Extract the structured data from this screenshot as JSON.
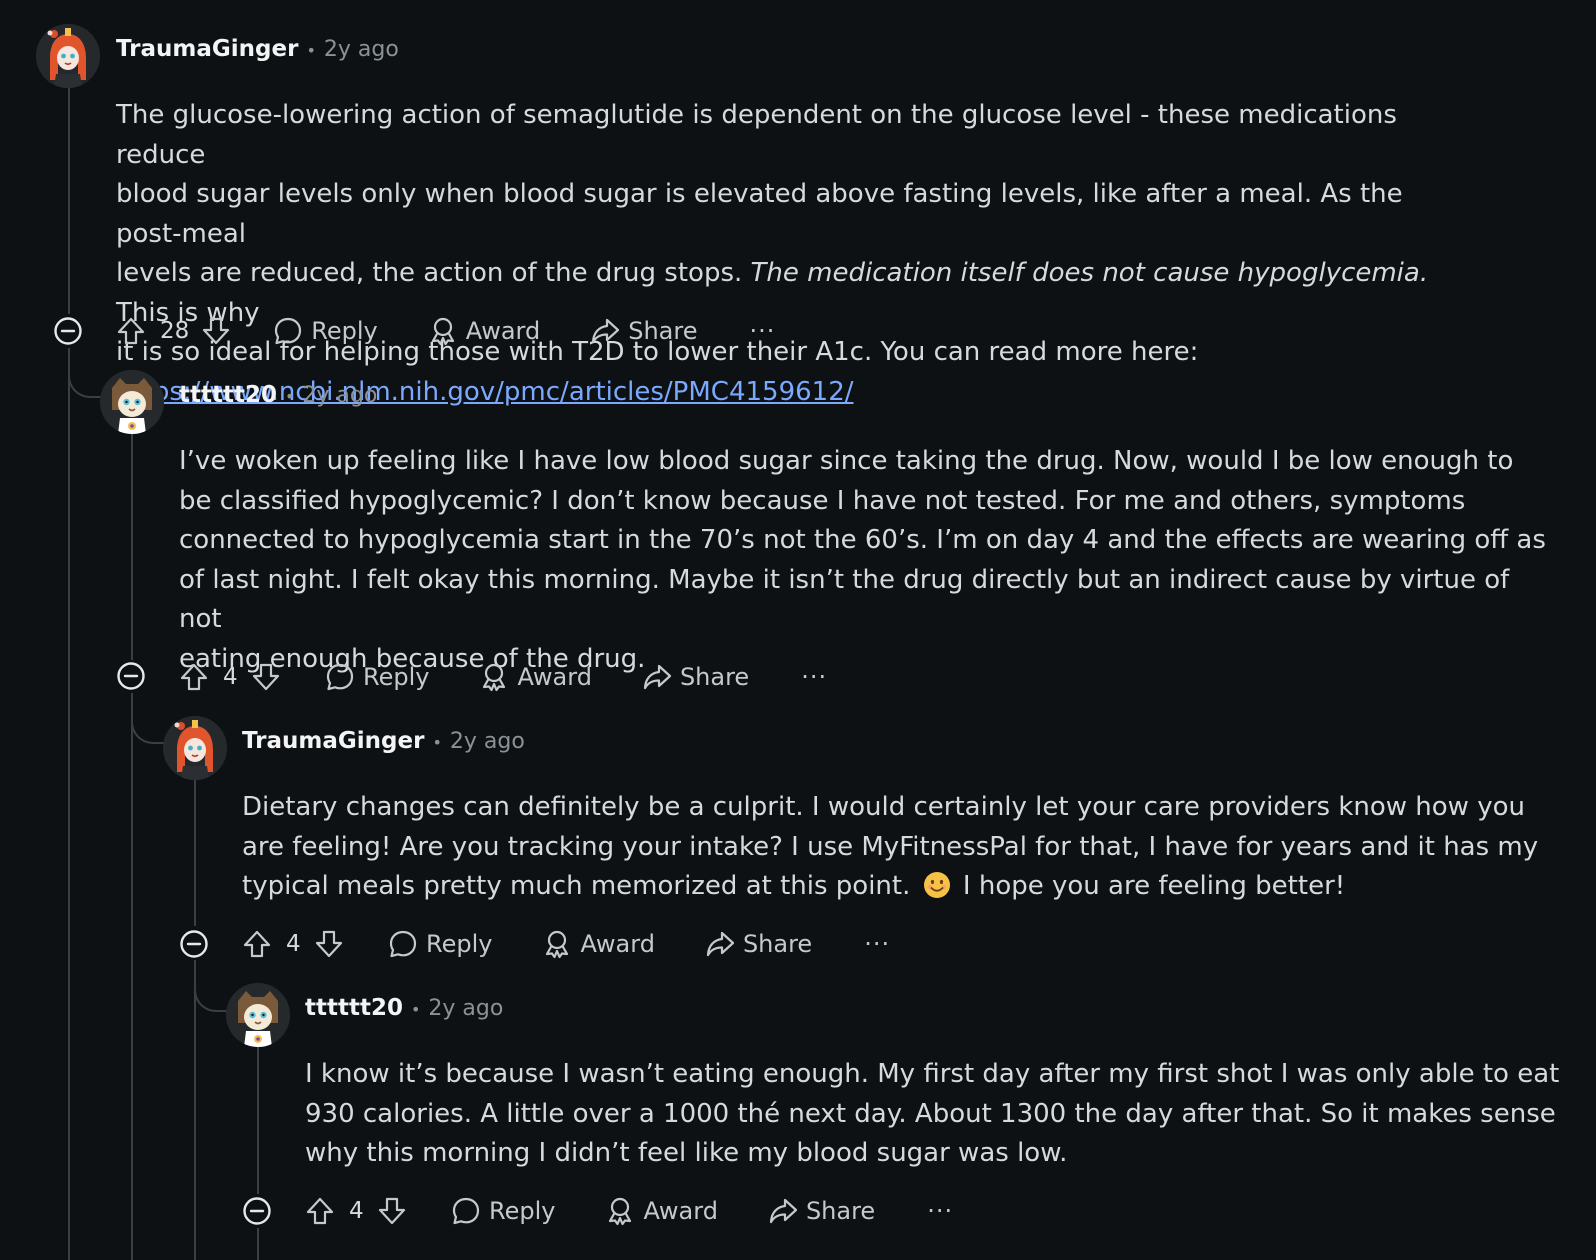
{
  "comments": [
    {
      "author": "TraumaGinger",
      "time": "2y ago",
      "body_line1": "The glucose-lowering action of semaglutide is dependent on the glucose level - these medications reduce",
      "body_line2": "blood sugar levels only when blood sugar is elevated above fasting levels, like after a meal. As the post-meal",
      "body_line3a": "levels are reduced, the action of the drug stops. ",
      "body_line3_italic": "The medication itself does not cause hypoglycemia.",
      "body_line3b": " This is why",
      "body_line4": "it is so ideal for helping those with T2D to lower their A1c. You can read more here:",
      "link": "https://www.ncbi.nlm.nih.gov/pmc/articles/PMC4159612/",
      "votes": "28",
      "reply_label": "Reply",
      "award_label": "Award",
      "share_label": "Share",
      "more_label": "···"
    },
    {
      "author": "tttttt20",
      "time": "2y ago",
      "body_line1": "I’ve woken up feeling like I have low blood sugar since taking the drug. Now, would I be low enough to",
      "body_line2": "be classified hypoglycemic? I don’t know because I have not tested. For me and others, symptoms",
      "body_line3": "connected to hypoglycemia start in the 70’s not the 60’s. I’m on day 4 and the effects are wearing off as",
      "body_line4": "of last night. I felt okay this morning. Maybe it isn’t the drug directly but an indirect cause by virtue of not",
      "body_line5": "eating enough because of the drug.",
      "votes": "4",
      "reply_label": "Reply",
      "award_label": "Award",
      "share_label": "Share",
      "more_label": "···"
    },
    {
      "author": "TraumaGinger",
      "time": "2y ago",
      "body_line1": "Dietary changes can definitely be a culprit. I would certainly let your care providers know how you",
      "body_line2": "are feeling! Are you tracking your intake? I use MyFitnessPal for that, I have for years and it has my",
      "body_line3a": "typical meals pretty much memorized at this point.",
      "body_line3b": "I hope you are feeling better!",
      "votes": "4",
      "reply_label": "Reply",
      "award_label": "Award",
      "share_label": "Share",
      "more_label": "···"
    },
    {
      "author": "tttttt20",
      "time": "2y ago",
      "body_line1": "I know it’s because I wasn’t eating enough. My first day after my first shot I was only able to eat",
      "body_line2": "930 calories. A little over a 1000 thé next day. About 1300 the day after that. So it makes sense",
      "body_line3": "why this morning I didn’t feel like my blood sugar was low.",
      "votes": "4",
      "reply_label": "Reply",
      "award_label": "Award",
      "share_label": "Share",
      "more_label": "···"
    }
  ],
  "colors": {
    "background": "#0e1113",
    "text": "#d7dadc",
    "meta": "#8b9297",
    "link": "#7aa9ff",
    "thread_line": "#3a3f42"
  },
  "icons": [
    "collapse-icon",
    "upvote-icon",
    "downvote-icon",
    "comment-icon",
    "award-icon",
    "share-icon",
    "more-icon",
    "smile-emoji"
  ]
}
